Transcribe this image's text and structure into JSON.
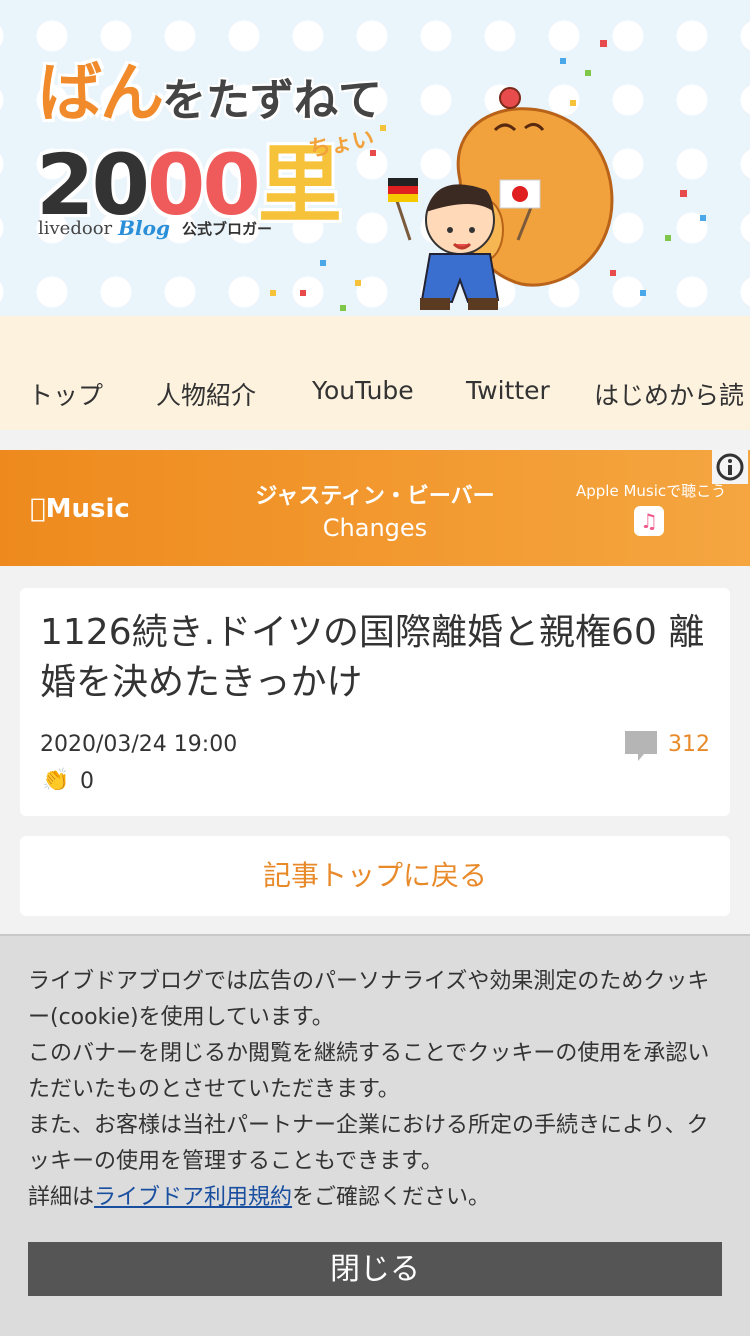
{
  "header": {
    "title_part1": "ばん",
    "title_part2": "をたずねて",
    "title_num1": "20",
    "title_num2": "00",
    "title_ri": "里",
    "title_choi": "ちょい",
    "blogger_livedoor": "livedoor",
    "blogger_blog": "Blog",
    "blogger_official": "公式ブロガー"
  },
  "nav": {
    "items": [
      "トップ",
      "人物紹介",
      "YouTube",
      "Twitter",
      "はじめから読"
    ]
  },
  "ad": {
    "logo": "Music",
    "artist": "ジャスティン・ビーバー",
    "song": "Changes",
    "cta": "Apple Musicで聴こう",
    "note_symbol": "♫",
    "info_icon": "info-icon"
  },
  "article": {
    "title": "1126続き.ドイツの国際離婚と親権60 離婚を決めたきっかけ",
    "date": "2020/03/24 19:00",
    "comment_count": "312",
    "clap_count": "0"
  },
  "back_link": "記事トップに戻る",
  "cookie": {
    "line1": "ライブドアブログでは広告のパーソナライズや効果測定のためクッキー(cookie)を使用しています。",
    "line2": "このバナーを閉じるか閲覧を継続することでクッキーの使用を承認いただいたものとさせていただきます。",
    "line3": "また、お客様は当社パートナー企業における所定の手続きにより、クッキーの使用を管理することもできます。",
    "line4_pre": "詳細は",
    "line4_link": "ライブドア利用規約",
    "line4_post": "をご確認ください。",
    "close_label": "閉じる"
  },
  "colors": {
    "accent_orange": "#e88a2a",
    "nav_bg": "#fdf2de",
    "ad_bg": "#f09a2e",
    "cookie_bg": "#dcdcdc",
    "close_bg": "#555555"
  }
}
